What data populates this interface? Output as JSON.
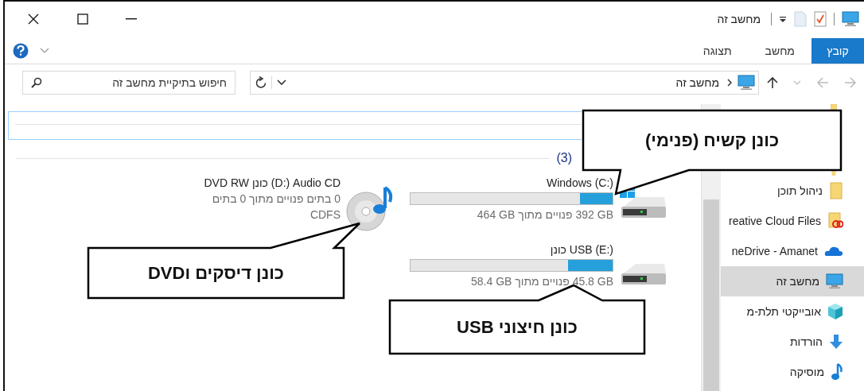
{
  "window": {
    "title": "מחשב זה"
  },
  "ribbon": {
    "tabs": [
      {
        "label": "קובץ",
        "selected": true
      },
      {
        "label": "מחשב",
        "selected": false
      },
      {
        "label": "תצוגה",
        "selected": false
      }
    ]
  },
  "address_bar": {
    "path": "מחשב זה"
  },
  "search": {
    "placeholder": "חיפוש בתיקיית מחשב זה"
  },
  "section": {
    "count": "(3)"
  },
  "drives": [
    {
      "kind": "system",
      "name": "Windows (C:)",
      "level": 0.16,
      "space": "392 GB פנויים מתוך 464 GB"
    },
    {
      "kind": "optical",
      "name": "DVD RW כונן (D:) Audio CD",
      "lines": [
        "0 בתים פנויים מתוך 0 בתים",
        "CDFS"
      ]
    },
    {
      "kind": "removable",
      "name": "כונן USB (E:)",
      "level": 0.22,
      "space": "45.8 GB פנויים מתוך 58.4 GB"
    }
  ],
  "sidebar": {
    "items": [
      {
        "kind": "folder",
        "label": "ניהול תוכן",
        "selected": false
      },
      {
        "kind": "cloud-folder",
        "label": "reative Cloud Files",
        "selected": false
      },
      {
        "kind": "cloud",
        "label": "neDrive - Amanet",
        "selected": false
      },
      {
        "kind": "computer",
        "label": "מחשב זה",
        "selected": true
      },
      {
        "kind": "cube",
        "label": "אובייקטי תלת-מ",
        "selected": false
      },
      {
        "kind": "download",
        "label": "הורדות",
        "selected": false
      },
      {
        "kind": "music",
        "label": "מוסיקה",
        "selected": false
      }
    ]
  },
  "callouts": [
    {
      "text": "כונן קשיח (פנימי)"
    },
    {
      "text": "כונן דיסקים וDVD"
    },
    {
      "text": "כונן חיצוני USB"
    }
  ]
}
